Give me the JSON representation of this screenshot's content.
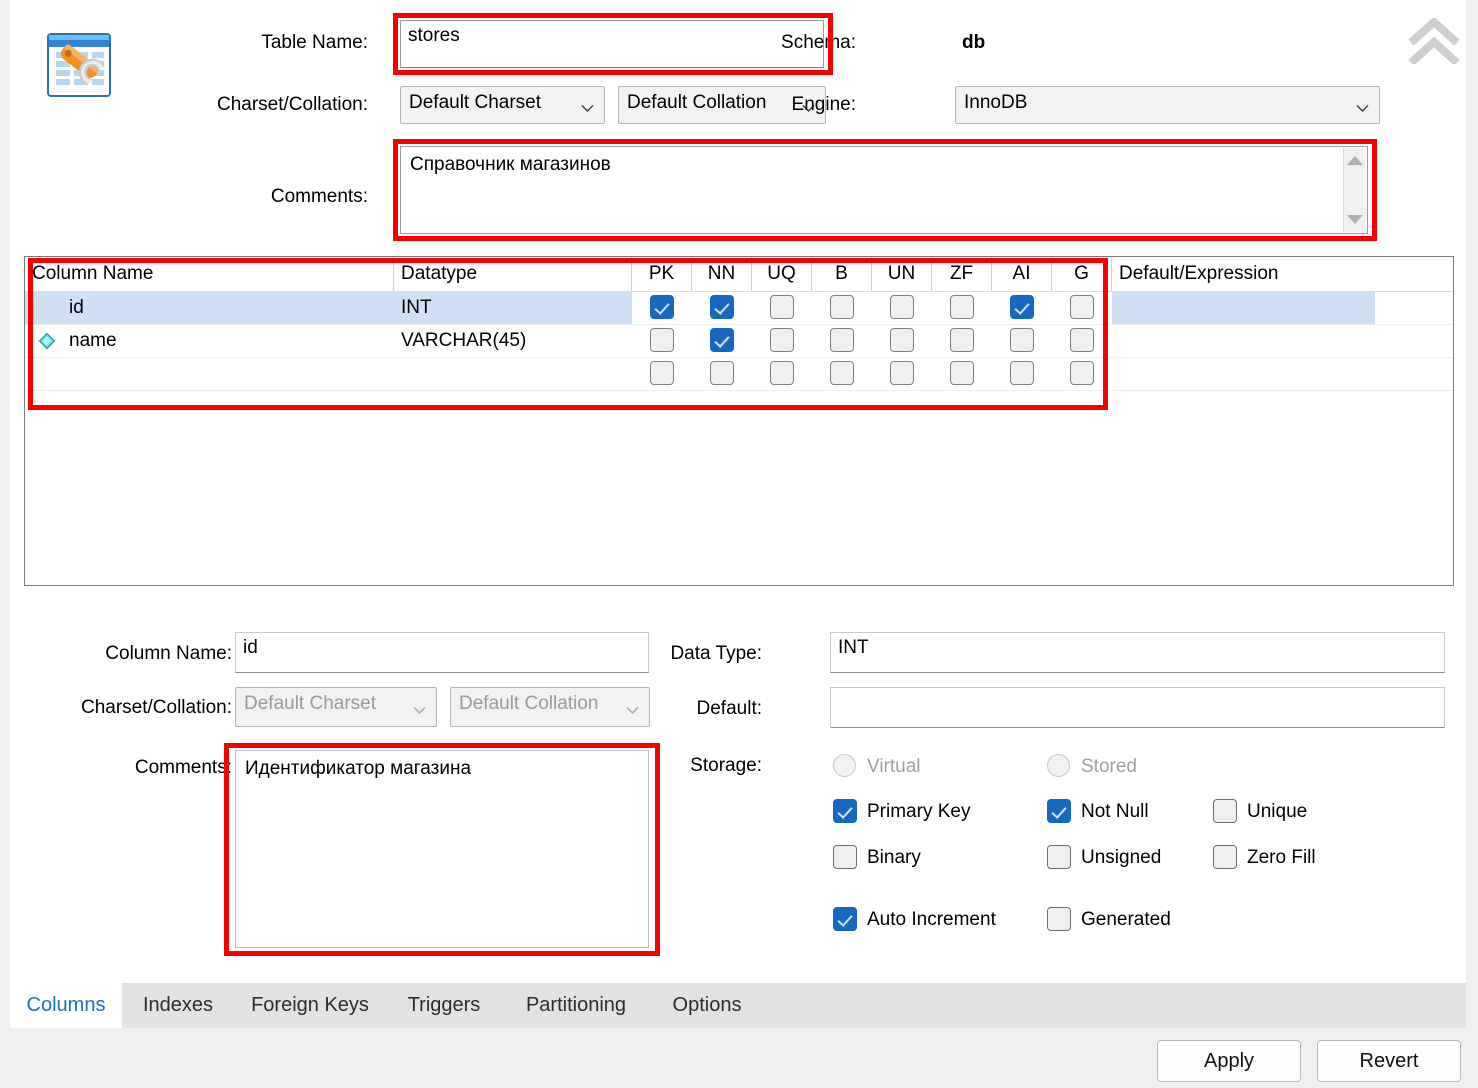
{
  "header": {
    "icon": "table-editor-icon",
    "collapse_icon": "double-chevron-up-icon",
    "table_name_label": "Table Name:",
    "table_name_value": "stores",
    "schema_label": "Schema:",
    "schema_value": "db",
    "charset_collation_label": "Charset/Collation:",
    "charset_value": "Default Charset",
    "collation_value": "Default Collation",
    "engine_label": "Engine:",
    "engine_value": "InnoDB",
    "comments_label": "Comments:",
    "comments_value": "Справочник магазинов"
  },
  "grid": {
    "headers": [
      "Column Name",
      "Datatype",
      "PK",
      "NN",
      "UQ",
      "B",
      "UN",
      "ZF",
      "AI",
      "G",
      "Default/Expression"
    ],
    "rows": [
      {
        "icon": "primary-key-icon",
        "name": "id",
        "datatype": "INT",
        "flags": {
          "PK": true,
          "NN": true,
          "UQ": false,
          "B": false,
          "UN": false,
          "ZF": false,
          "AI": true,
          "G": false
        },
        "default": "",
        "selected": true
      },
      {
        "icon": "column-diamond-icon",
        "name": "name",
        "datatype": "VARCHAR(45)",
        "flags": {
          "PK": false,
          "NN": true,
          "UQ": false,
          "B": false,
          "UN": false,
          "ZF": false,
          "AI": false,
          "G": false
        },
        "default": "",
        "selected": false
      },
      {
        "icon": "",
        "name": "",
        "datatype": "",
        "flags": {
          "PK": false,
          "NN": false,
          "UQ": false,
          "B": false,
          "UN": false,
          "ZF": false,
          "AI": false,
          "G": false
        },
        "default": "",
        "selected": false
      }
    ]
  },
  "details": {
    "column_name_label": "Column Name:",
    "column_name_value": "id",
    "charset_collation_label": "Charset/Collation:",
    "charset_value": "Default Charset",
    "collation_value": "Default Collation",
    "comments_label": "Comments:",
    "comments_value": "Идентификатор магазина",
    "data_type_label": "Data Type:",
    "data_type_value": "INT",
    "default_label": "Default:",
    "default_value": "",
    "storage_label": "Storage:",
    "virtual_label": "Virtual",
    "stored_label": "Stored",
    "primary_key_label": "Primary Key",
    "primary_key_checked": true,
    "not_null_label": "Not Null",
    "not_null_checked": true,
    "unique_label": "Unique",
    "unique_checked": false,
    "binary_label": "Binary",
    "binary_checked": false,
    "unsigned_label": "Unsigned",
    "unsigned_checked": false,
    "zero_fill_label": "Zero Fill",
    "zero_fill_checked": false,
    "auto_increment_label": "Auto Increment",
    "auto_increment_checked": true,
    "generated_label": "Generated",
    "generated_checked": false
  },
  "tabs": [
    {
      "label": "Columns",
      "active": true
    },
    {
      "label": "Indexes",
      "active": false
    },
    {
      "label": "Foreign Keys",
      "active": false
    },
    {
      "label": "Triggers",
      "active": false
    },
    {
      "label": "Partitioning",
      "active": false
    },
    {
      "label": "Options",
      "active": false
    }
  ],
  "buttons": {
    "apply": "Apply",
    "revert": "Revert"
  },
  "colors": {
    "highlight_red": "#f80000",
    "accent_blue": "#1668c1",
    "selected_row": "#cfe0f5",
    "active_tab_text": "#1c6fc4"
  }
}
